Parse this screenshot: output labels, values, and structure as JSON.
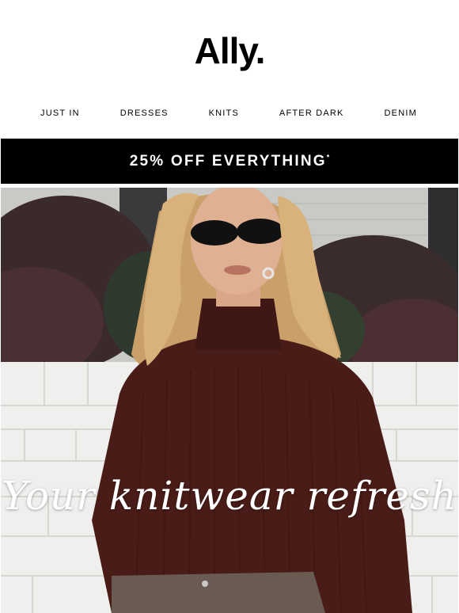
{
  "brand": {
    "name": "Ally."
  },
  "nav": {
    "items": [
      {
        "label": "JUST IN"
      },
      {
        "label": "DRESSES"
      },
      {
        "label": "KNITS"
      },
      {
        "label": "AFTER DARK"
      },
      {
        "label": "DENIM"
      }
    ]
  },
  "promo": {
    "text": "25% OFF EVERYTHING",
    "mark": "*"
  },
  "hero": {
    "headline": "Your knitwear refresh"
  },
  "colors": {
    "banner": "#000000",
    "sweater": "#4a1c18",
    "text_on_banner": "#ffffff"
  }
}
